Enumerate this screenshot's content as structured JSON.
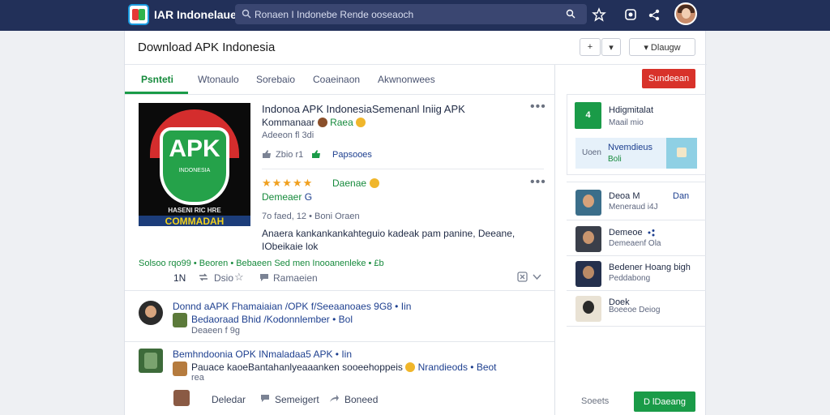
{
  "topbar": {
    "app_title": "IAR Indonelaue",
    "search_placeholder": "Ronaen I Indonebe Rende ooseaoch"
  },
  "page": {
    "title": "Download APK Indonesia",
    "add_label": "+",
    "dropdown_label": "▾",
    "filter_label": "▾ Dlaugw"
  },
  "tabs": [
    {
      "label": "Psnteti"
    },
    {
      "label": "Wtonaulo"
    },
    {
      "label": "Sorebaio"
    },
    {
      "label": "Coaeinaon"
    },
    {
      "label": "Akwnonwees"
    }
  ],
  "post": {
    "poster_title": "APK",
    "poster_sub": "INDONESIA",
    "poster_band_top": "HASENI RIC HRE",
    "poster_band_bottom": "COMMADAH",
    "title": "Indonoa APK IndonesiaSemenanl Iniig APK",
    "author": "Kommanaar",
    "author_tag": "Raea",
    "time": "Adeeon fl 3di",
    "likes_label": "Zbio r1",
    "shares_label": "Papsooes",
    "stars": "★★★★★",
    "rating_label": "Daenae",
    "sub_author": "Demeaer",
    "sub_author_tag": "G",
    "meta_line": "7o faed, 12 • Boni Oraen",
    "body": "Anaera kankankankahteguio kadeak pam panine, Deeane, IObeikaie lok",
    "footer_line": "Solsoo rqo99 • Beoren • Bebaeen Sed men Inooanenleke • £b",
    "count": "1N",
    "repost": "Dsio",
    "reply_label": "Ramaeien"
  },
  "comments": [
    {
      "title": "Donnd aAPK Fhamaiaian /OPK f/Seeaanoaes 9G8 • Iin",
      "subline": "Bedaoraad Bhid /Kodonnlember • Bol",
      "time": "Deaeen f 9g"
    },
    {
      "title": "Bemhndoonia OPK INmaladaa5 APK • Iin",
      "subline": "Pauace kaoeBantahanlyeaaanken sooeehoppeis",
      "subline_tag": "Nrandieods • Beot",
      "time": "rea"
    }
  ],
  "actions": {
    "like": "Deledar",
    "comment": "Semeigert",
    "share": "Boneed"
  },
  "sidebar": {
    "cta_red": "Sundeean",
    "card_title": "Hdigmitalat",
    "card_sub": "Maail mio",
    "feature_label": "Uoen",
    "feature_title": "Nvemdieus",
    "feature_sub": "Boli",
    "items": [
      {
        "name": "Deoa M",
        "meta": "Dan",
        "sub": "Meneraud i4J"
      },
      {
        "name": "Demeoe",
        "meta": "",
        "sub": "Demeaenf Ola"
      },
      {
        "name": "Bedener Hoang bigh",
        "meta": "",
        "sub": "Peddabong"
      },
      {
        "name": "Doek",
        "meta": "",
        "sub": "Boeeoe Deiog"
      }
    ],
    "footer_muted": "Soeets",
    "cta_green": "D lDaeang"
  },
  "colors": {
    "topbar": "#223059",
    "accent_green": "#1a9b48",
    "accent_red": "#d8322a",
    "link_blue": "#1d3f8f"
  }
}
